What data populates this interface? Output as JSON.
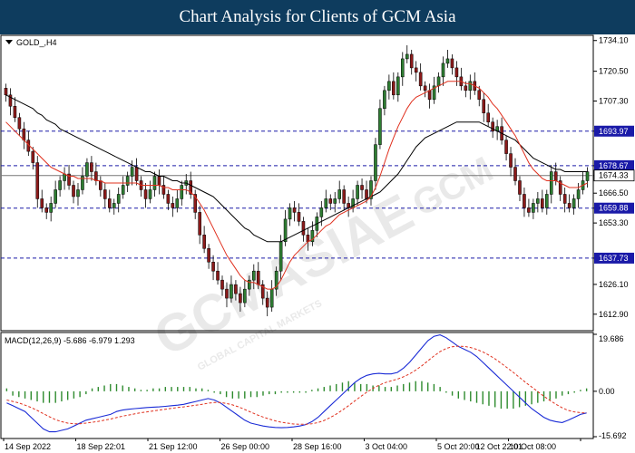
{
  "header": {
    "title": "Chart Analysis for Clients of GCM Asia"
  },
  "watermark": {
    "main": "GCMASIAE",
    "tag": "GCM",
    "sub": "GLOBAL CAPITAL MARKETS"
  },
  "colors": {
    "header_bg": "#0e3c5e",
    "bull": "#2e7d32",
    "bear": "#8b1a1a",
    "ma_fast": "#e0301e",
    "ma_slow": "#000000",
    "level_line": "#1a1aa8",
    "macd_line": "#1a2bd6",
    "signal_line": "#e0301e",
    "hist": "#2e8b2e"
  },
  "chart_data": [
    {
      "type": "candlestick",
      "symbol_label": "GOLD_,H4",
      "ylim": [
        1606,
        1736
      ],
      "y_ticks": [
        "1734.10",
        "1720.50",
        "1707.30",
        "1693.97",
        "1678.67",
        "1674.33",
        "1666.50",
        "1659.88",
        "1653.30",
        "1637.73",
        "1626.10",
        "1612.90"
      ],
      "x_labels": [
        "14 Sep 2022",
        "18 Sep 22:01",
        "21 Sep 12:00",
        "26 Sep 00:00",
        "28 Sep 16:00",
        "3 Oct 04:00",
        "5 Oct 20:00",
        "10 Oct 08:00",
        "12 Oct 22:01"
      ],
      "levels": [
        {
          "value": 1693.97,
          "label": "1693.97"
        },
        {
          "value": 1678.67,
          "label": "1678.67"
        },
        {
          "value": 1659.88,
          "label": "1659.88"
        },
        {
          "value": 1637.73,
          "label": "1637.73"
        }
      ],
      "current_price": {
        "value": 1674.33,
        "label": "1674.33"
      },
      "closes": [
        1710,
        1705,
        1700,
        1695,
        1690,
        1685,
        1680,
        1664,
        1660,
        1658,
        1662,
        1668,
        1672,
        1675,
        1670,
        1665,
        1668,
        1674,
        1680,
        1676,
        1672,
        1668,
        1664,
        1660,
        1662,
        1666,
        1670,
        1674,
        1678,
        1672,
        1668,
        1664,
        1668,
        1674,
        1670,
        1666,
        1662,
        1660,
        1664,
        1670,
        1672,
        1666,
        1658,
        1648,
        1642,
        1636,
        1632,
        1628,
        1624,
        1620,
        1626,
        1622,
        1618,
        1624,
        1628,
        1632,
        1626,
        1620,
        1616,
        1624,
        1632,
        1645,
        1655,
        1660,
        1658,
        1654,
        1648,
        1645,
        1650,
        1656,
        1660,
        1664,
        1662,
        1664,
        1668,
        1662,
        1660,
        1664,
        1670,
        1668,
        1664,
        1672,
        1688,
        1704,
        1712,
        1716,
        1710,
        1718,
        1726,
        1728,
        1722,
        1720,
        1714,
        1712,
        1708,
        1714,
        1718,
        1724,
        1726,
        1722,
        1718,
        1714,
        1712,
        1716,
        1712,
        1708,
        1702,
        1698,
        1694,
        1696,
        1690,
        1684,
        1678,
        1672,
        1666,
        1660,
        1658,
        1662,
        1664,
        1660,
        1666,
        1676,
        1672,
        1666,
        1662,
        1660,
        1664,
        1668,
        1672,
        1676
      ],
      "ma_fast": [
        1698,
        1696,
        1694,
        1692,
        1690,
        1688,
        1686,
        1684,
        1682,
        1680,
        1678,
        1677,
        1676,
        1675,
        1674,
        1674,
        1673,
        1673,
        1673,
        1673,
        1672,
        1672,
        1671,
        1671,
        1671,
        1671,
        1671,
        1671,
        1671,
        1671,
        1670,
        1670,
        1670,
        1670,
        1670,
        1669,
        1669,
        1668,
        1668,
        1668,
        1668,
        1667,
        1665,
        1662,
        1659,
        1655,
        1651,
        1647,
        1643,
        1639,
        1636,
        1633,
        1630,
        1628,
        1627,
        1627,
        1626,
        1625,
        1624,
        1624,
        1625,
        1628,
        1632,
        1636,
        1639,
        1641,
        1643,
        1645,
        1646,
        1648,
        1650,
        1652,
        1653,
        1655,
        1657,
        1658,
        1659,
        1660,
        1661,
        1662,
        1663,
        1665,
        1669,
        1674,
        1680,
        1686,
        1691,
        1696,
        1700,
        1704,
        1707,
        1709,
        1710,
        1711,
        1712,
        1713,
        1714,
        1715,
        1716,
        1716,
        1716,
        1716,
        1715,
        1715,
        1714,
        1713,
        1711,
        1709,
        1706,
        1704,
        1701,
        1698,
        1695,
        1692,
        1688,
        1684,
        1680,
        1677,
        1675,
        1673,
        1672,
        1672,
        1672,
        1671,
        1670,
        1669,
        1669,
        1669,
        1670,
        1671
      ],
      "ma_slow": [
        1710,
        1709,
        1708,
        1707,
        1706,
        1705,
        1704,
        1702,
        1701,
        1699,
        1698,
        1697,
        1695,
        1694,
        1693,
        1692,
        1691,
        1690,
        1689,
        1688,
        1687,
        1686,
        1685,
        1684,
        1683,
        1682,
        1681,
        1680,
        1679,
        1678,
        1677,
        1676,
        1676,
        1675,
        1674,
        1674,
        1673,
        1672,
        1672,
        1671,
        1671,
        1670,
        1669,
        1668,
        1667,
        1666,
        1665,
        1663,
        1661,
        1659,
        1657,
        1655,
        1653,
        1651,
        1650,
        1648,
        1647,
        1646,
        1645,
        1645,
        1645,
        1645,
        1646,
        1647,
        1648,
        1649,
        1650,
        1651,
        1652,
        1653,
        1654,
        1655,
        1656,
        1657,
        1658,
        1659,
        1660,
        1661,
        1662,
        1663,
        1664,
        1665,
        1666,
        1667,
        1669,
        1671,
        1673,
        1675,
        1678,
        1681,
        1684,
        1687,
        1689,
        1691,
        1692,
        1693,
        1694,
        1695,
        1696,
        1697,
        1698,
        1698,
        1698,
        1698,
        1698,
        1698,
        1697,
        1696,
        1695,
        1694,
        1693,
        1692,
        1691,
        1690,
        1688,
        1686,
        1684,
        1682,
        1681,
        1680,
        1679,
        1678,
        1677,
        1677,
        1676,
        1676,
        1676,
        1676,
        1676,
        1676
      ]
    },
    {
      "type": "macd",
      "label": "MACD(12,26,9) -5.686 -6.979 1.293",
      "ylim": [
        -15.692,
        19.686
      ],
      "y_ticks": [
        "19.686",
        "0.00",
        "-15.692"
      ],
      "macd": [
        -4,
        -5,
        -6,
        -7,
        -9,
        -11,
        -13,
        -14,
        -14,
        -13.5,
        -13,
        -12,
        -11,
        -10,
        -9.5,
        -9,
        -8.5,
        -8,
        -7,
        -6.5,
        -6.2,
        -6,
        -5.8,
        -5.6,
        -5.5,
        -5.4,
        -5.2,
        -5,
        -4.8,
        -4.5,
        -4,
        -3.5,
        -3,
        -2.5,
        -3,
        -4,
        -5.5,
        -7,
        -8.5,
        -10,
        -11,
        -11.5,
        -12,
        -12.3,
        -12.5,
        -12.6,
        -12.5,
        -12.3,
        -12,
        -11.5,
        -10.5,
        -9,
        -7,
        -5,
        -3,
        -1,
        1,
        3,
        4.5,
        5.5,
        6,
        6.2,
        6,
        6,
        6.5,
        8,
        10,
        12.5,
        15,
        17.5,
        19,
        19.5,
        18.5,
        17,
        15.5,
        14.5,
        13.5,
        12,
        10,
        8,
        6,
        4,
        2,
        0,
        -2,
        -4,
        -6,
        -7.5,
        -9,
        -10,
        -10.5,
        -10.8,
        -10,
        -9,
        -8,
        -7.5
      ],
      "signal": [
        -3,
        -3.5,
        -4,
        -4.8,
        -5.6,
        -6.6,
        -7.7,
        -8.8,
        -9.8,
        -10.5,
        -11,
        -11.2,
        -11.2,
        -11,
        -10.7,
        -10.4,
        -10,
        -9.6,
        -9.1,
        -8.6,
        -8.2,
        -7.8,
        -7.4,
        -7.1,
        -6.8,
        -6.5,
        -6.2,
        -5.9,
        -5.6,
        -5.4,
        -5.1,
        -4.8,
        -4.5,
        -4.1,
        -3.9,
        -3.9,
        -4.2,
        -4.7,
        -5.4,
        -6.3,
        -7.2,
        -8.1,
        -8.9,
        -9.6,
        -10.2,
        -10.7,
        -11,
        -11.3,
        -11.4,
        -11.4,
        -11.2,
        -10.8,
        -10.1,
        -9.1,
        -7.9,
        -6.5,
        -5,
        -3.4,
        -1.8,
        -0.3,
        1,
        2.1,
        3,
        3.6,
        4.2,
        5,
        6,
        7.3,
        8.8,
        10.5,
        12.2,
        13.7,
        14.8,
        15.4,
        15.6,
        15.5,
        15.1,
        14.5,
        13.6,
        12.5,
        11.2,
        9.7,
        8.1,
        6.5,
        4.8,
        3.1,
        1.5,
        -0.1,
        -1.7,
        -3.2,
        -4.5,
        -5.7,
        -6.6,
        -7.1,
        -7.4,
        -7.5
      ],
      "histogram": [
        1,
        -1.5,
        -2,
        -2.5,
        -3,
        -3.5,
        -4,
        -4,
        -4,
        -3.5,
        -3,
        -2.5,
        -2,
        -1,
        1,
        1.5,
        2,
        2.5,
        2.5,
        2,
        1.5,
        1,
        0.5,
        0.5,
        1,
        1,
        1.5,
        1.5,
        1.5,
        1.5,
        1.5,
        1,
        1,
        0.5,
        -0.5,
        -1,
        -2,
        -2.5,
        -2.5,
        -2.5,
        -2,
        -2,
        -1.5,
        -1,
        -1,
        -0.5,
        -0.5,
        -0.5,
        -0.5,
        -0.5,
        0.5,
        1,
        1.5,
        2,
        2.5,
        3,
        3.5,
        3,
        2.5,
        2.5,
        2,
        2,
        1.5,
        1.5,
        2,
        2.5,
        3,
        3.5,
        3.5,
        3,
        2.5,
        1.5,
        -0.5,
        -1.5,
        -2.5,
        -3,
        -3.5,
        -4,
        -4.5,
        -5,
        -5.5,
        -6,
        -6,
        -6,
        -5.5,
        -5,
        -4.5,
        -4,
        -3.5,
        -3,
        -2.5,
        -1.5,
        -1,
        -0.5,
        0.5,
        1
      ]
    }
  ]
}
